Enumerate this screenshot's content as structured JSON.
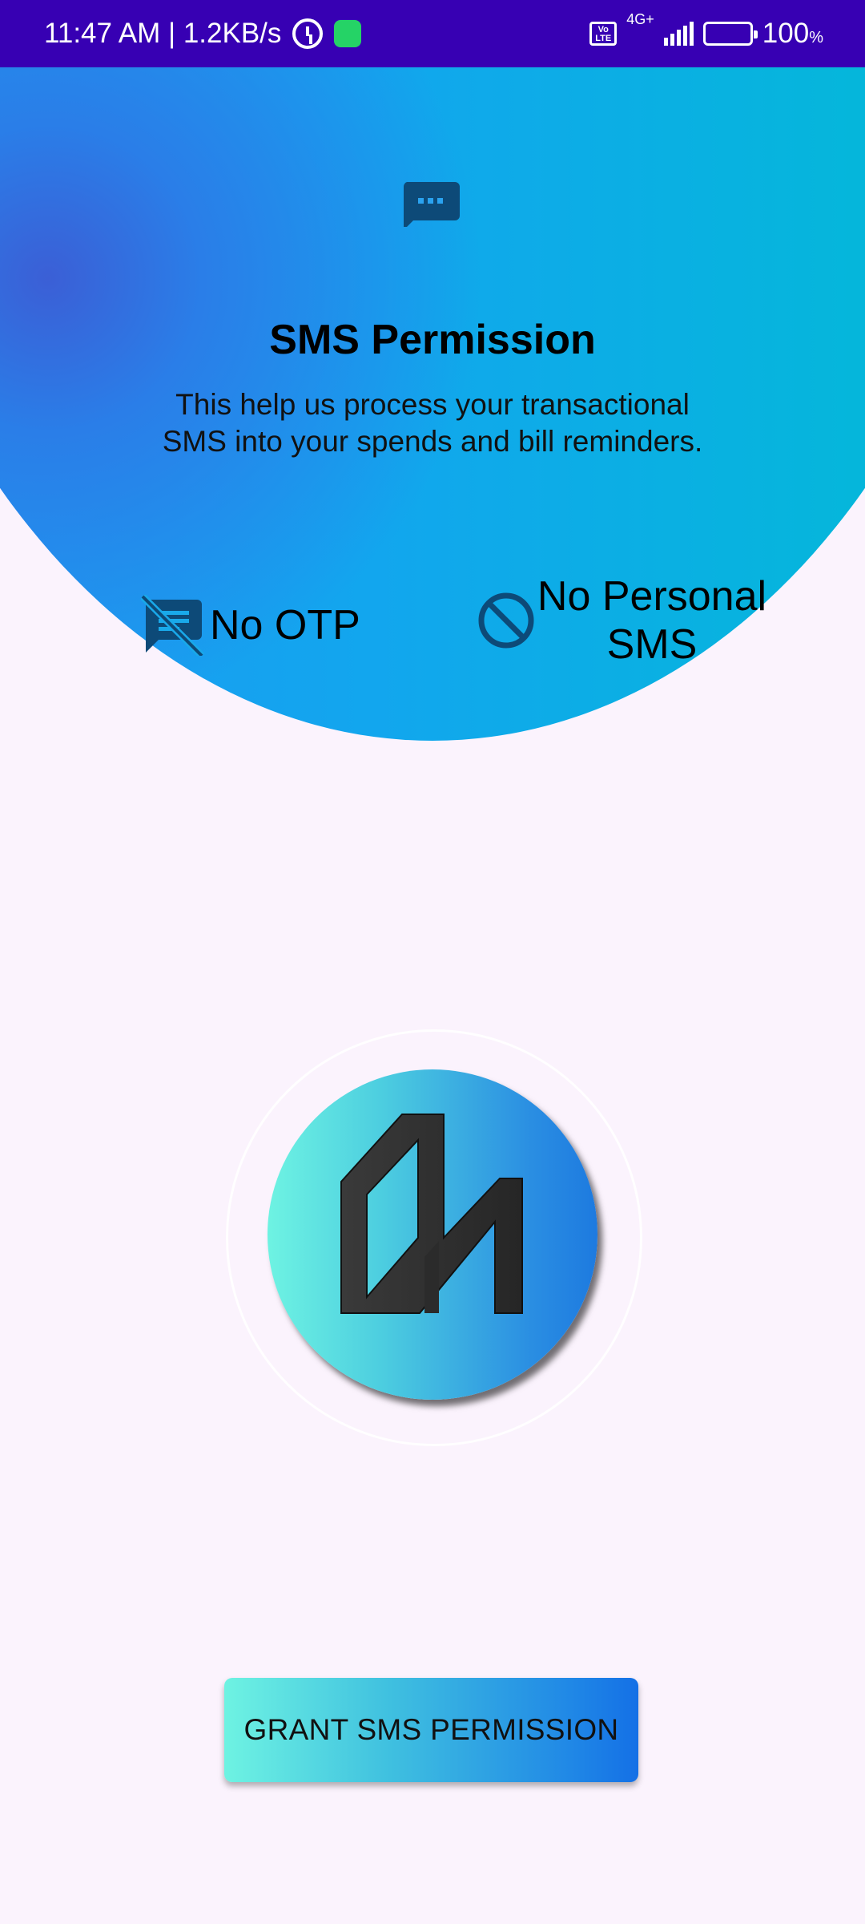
{
  "status_bar": {
    "time_speed": "11:47 AM | 1.2KB/s",
    "network": "4G+",
    "volte": "Vo LTE",
    "battery": "100",
    "battery_unit": "%",
    "battery_level": 1.0
  },
  "header": {
    "icon": "sms-message-icon",
    "title": "SMS Permission",
    "description": "This help us process your transactional SMS into your spends and bill reminders."
  },
  "features": [
    {
      "icon": "no-otp-sms-icon",
      "label": "No OTP"
    },
    {
      "icon": "block-icon",
      "label": "No Personal SMS"
    }
  ],
  "logo": {
    "name": "app-logo"
  },
  "action": {
    "label": "GRANT SMS PERMISSION"
  },
  "colors": {
    "status_bar": "#3700b3",
    "background": "#fbf3fd",
    "hero_start": "#2196f3",
    "hero_end": "#00bcd4",
    "icon_color": "#0d4a78",
    "button_start": "#6ef3e2",
    "button_end": "#1470e6"
  }
}
